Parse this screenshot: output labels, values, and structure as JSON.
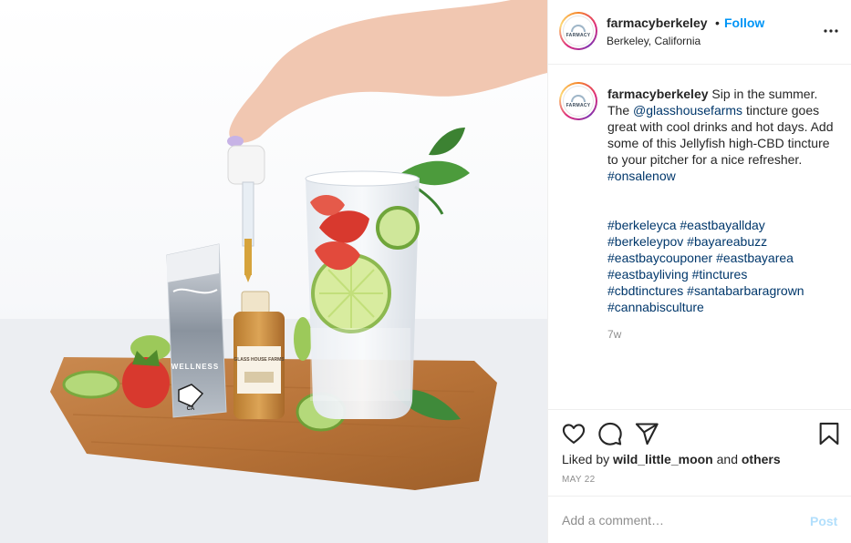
{
  "post": {
    "username": "farmacyberkeley",
    "follow_separator": "•",
    "follow_label": "Follow",
    "location": "Berkeley, California",
    "avatar_text": "FARMACY",
    "more_icon": "more-horizontal-icon"
  },
  "caption": {
    "username": "farmacyberkeley",
    "text_part1": "Sip in the summer. The",
    "mention": "@glasshousefarms",
    "text_part2": "tincture goes great with cool drinks and hot days. Add some of this Jellyfish high-CBD tincture to your pitcher for a nice refresher.",
    "hashtag": "#onsalenow",
    "tags": [
      "#berkeleyca",
      "#eastbayallday",
      "#berkeleypov",
      "#bayareabuzz",
      "#eastbaycouponer",
      "#eastbayarea",
      "#eastbayliving",
      "#tinctures",
      "#cbdtinctures",
      "#santabarbaragrown",
      "#cannabisculture"
    ],
    "age": "7w"
  },
  "actions": {
    "like_icon": "heart-icon",
    "comment_icon": "comment-icon",
    "share_icon": "share-icon",
    "save_icon": "bookmark-icon",
    "liked_prefix": "Liked by",
    "liked_user": "wild_little_moon",
    "liked_and": "and",
    "liked_others": "others",
    "date": "MAY 22"
  },
  "comment": {
    "placeholder": "Add a comment…",
    "post_label": "Post"
  },
  "photo": {
    "box_label": "WELLNESS",
    "bottle_label": "GLASS HOUSE FARMS",
    "ca_label": "CA"
  },
  "colors": {
    "accent": "#0095f6",
    "link": "#00376b",
    "muted": "#8e8e8e",
    "post_disabled": "#b2dffc"
  }
}
